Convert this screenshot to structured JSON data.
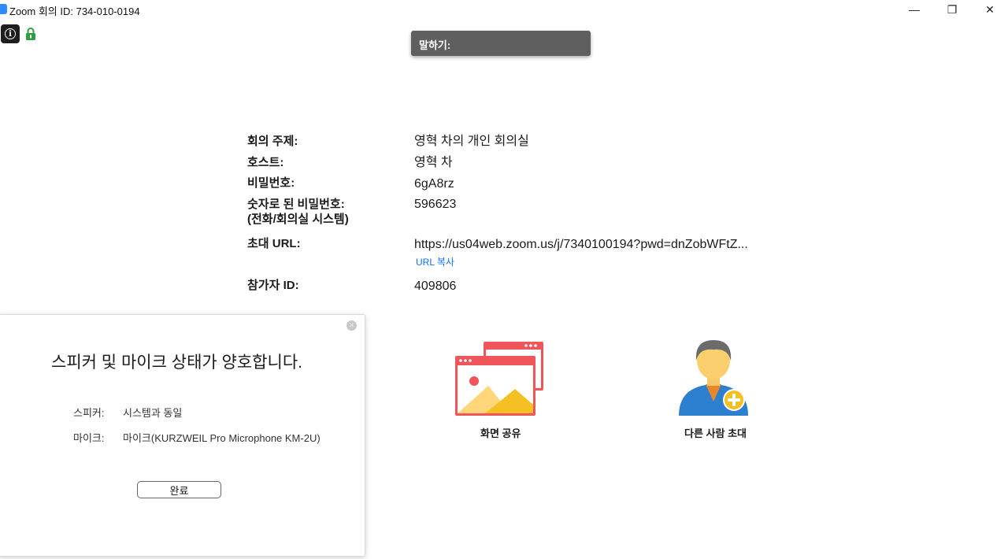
{
  "window": {
    "title": "Zoom 회의 ID: 734-010-0194",
    "icons": [
      "zoom-logo-icon",
      "minimize-icon",
      "restore-icon",
      "close-icon"
    ],
    "controls": {
      "minimize": "—",
      "restore": "❐",
      "close": "✕"
    }
  },
  "top_icons": {
    "info": "i",
    "lock_color": "#2ea043"
  },
  "speaking": {
    "label": "말하기:"
  },
  "meeting_info": {
    "topic_label": "회의 주제:",
    "topic_value": "영혁 차의 개인 회의실",
    "host_label": "호스트:",
    "host_value": "영혁 차",
    "password_label": "비밀번호:",
    "password_value": "6gA8rz",
    "numeric_password_label_line1": "숫자로 된 비밀번호:",
    "numeric_password_label_line2": "(전화/회의실 시스템)",
    "numeric_password_value": "596623",
    "invite_url_label": "초대 URL:",
    "invite_url_value": "https://us04web.zoom.us/j/7340100194?pwd=dnZobWFtZ...",
    "copy_url_label": "URL 복사",
    "participant_id_label": "참가자 ID:",
    "participant_id_value": "409806"
  },
  "actions": {
    "share_screen_label": "화면 공유",
    "invite_label": "다른 사람 초대",
    "share_color": "#f0555a",
    "invite_color": "#2d7fd0"
  },
  "audio_dialog": {
    "title": "스피커 및 마이크 상태가 양호합니다.",
    "speaker_label": "스피커:",
    "speaker_value": "시스템과 동일",
    "mic_label": "마이크:",
    "mic_value": "마이크(KURZWEIL Pro Microphone KM-2U)",
    "done_label": "완료",
    "close_glyph": "×"
  }
}
